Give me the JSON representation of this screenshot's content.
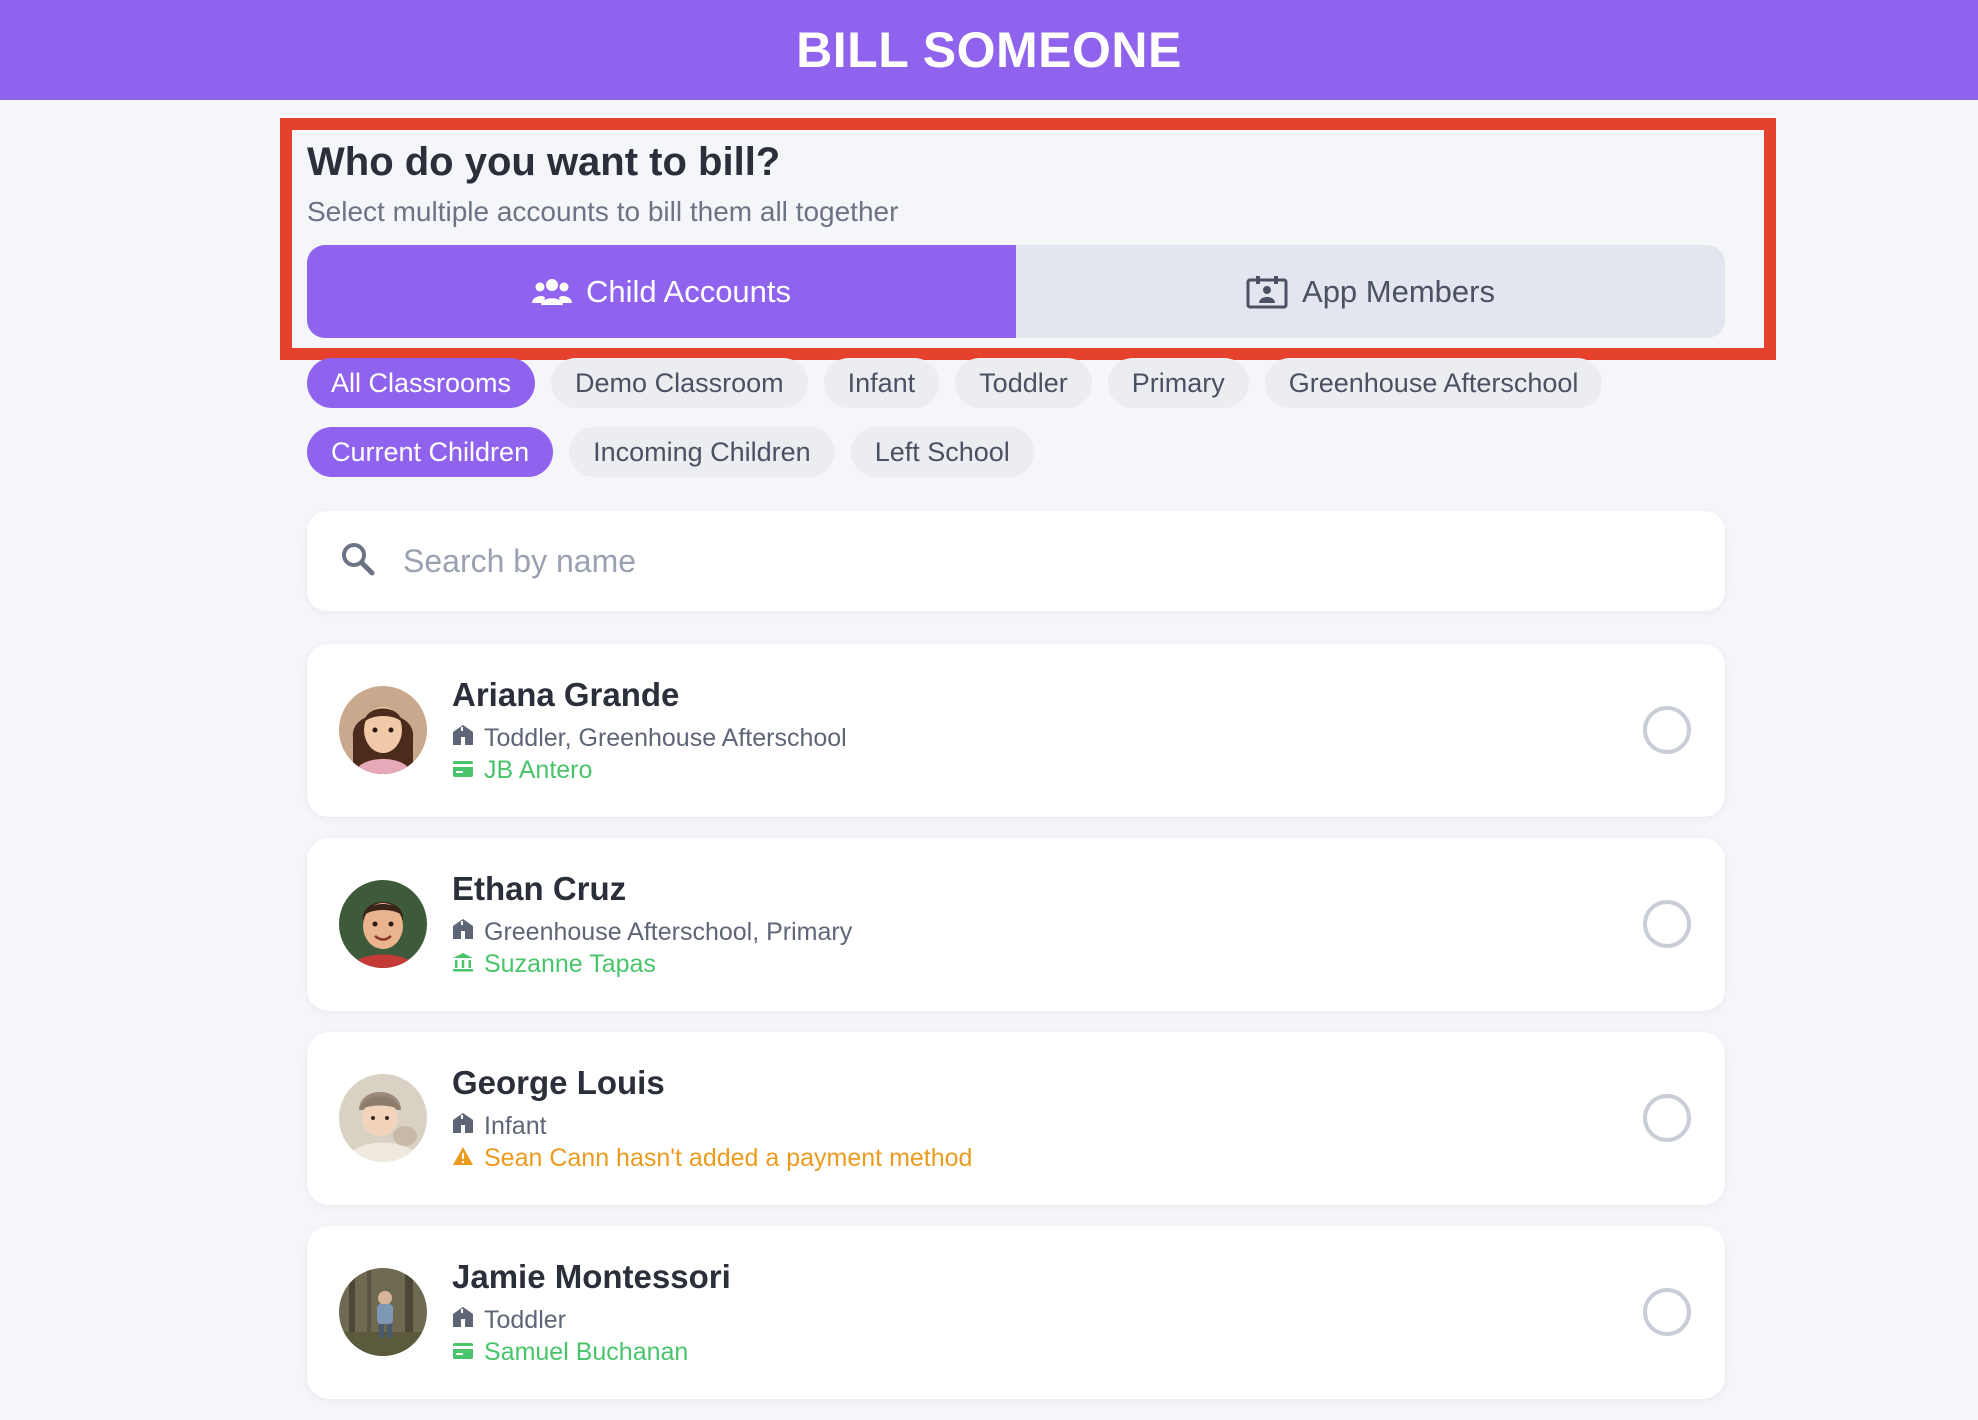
{
  "header": {
    "title": "BILL SOMEONE"
  },
  "prompt": {
    "title": "Who do you want to bill?",
    "subtitle": "Select multiple accounts to bill them all together"
  },
  "tabs": {
    "child_accounts": "Child Accounts",
    "app_members": "App Members",
    "active": "child_accounts"
  },
  "classroom_filters": [
    "All Classrooms",
    "Demo Classroom",
    "Infant",
    "Toddler",
    "Primary",
    "Greenhouse Afterschool"
  ],
  "classroom_selected": "All Classrooms",
  "status_filters": [
    "Current Children",
    "Incoming Children",
    "Left School"
  ],
  "status_selected": "Current Children",
  "search": {
    "placeholder": "Search by name",
    "value": ""
  },
  "children": [
    {
      "name": "Ariana Grande",
      "classrooms": "Toddler, Greenhouse Afterschool",
      "payer": "JB Antero",
      "payer_icon": "card-icon",
      "status": "ok",
      "selected": false
    },
    {
      "name": "Ethan Cruz",
      "classrooms": "Greenhouse Afterschool, Primary",
      "payer": "Suzanne Tapas",
      "payer_icon": "bank-icon",
      "status": "ok",
      "selected": false
    },
    {
      "name": "George Louis",
      "classrooms": "Infant",
      "payer": "Sean Cann hasn't added a payment method",
      "payer_icon": "warning-icon",
      "status": "warn",
      "selected": false
    },
    {
      "name": "Jamie Montessori",
      "classrooms": "Toddler",
      "payer": "Samuel Buchanan",
      "payer_icon": "card-icon",
      "status": "ok",
      "selected": false
    }
  ],
  "colors": {
    "brand": "#9063ee",
    "highlight_border": "#e5412c",
    "payment_ok": "#49c46a",
    "payment_warning": "#eb9b1e"
  }
}
